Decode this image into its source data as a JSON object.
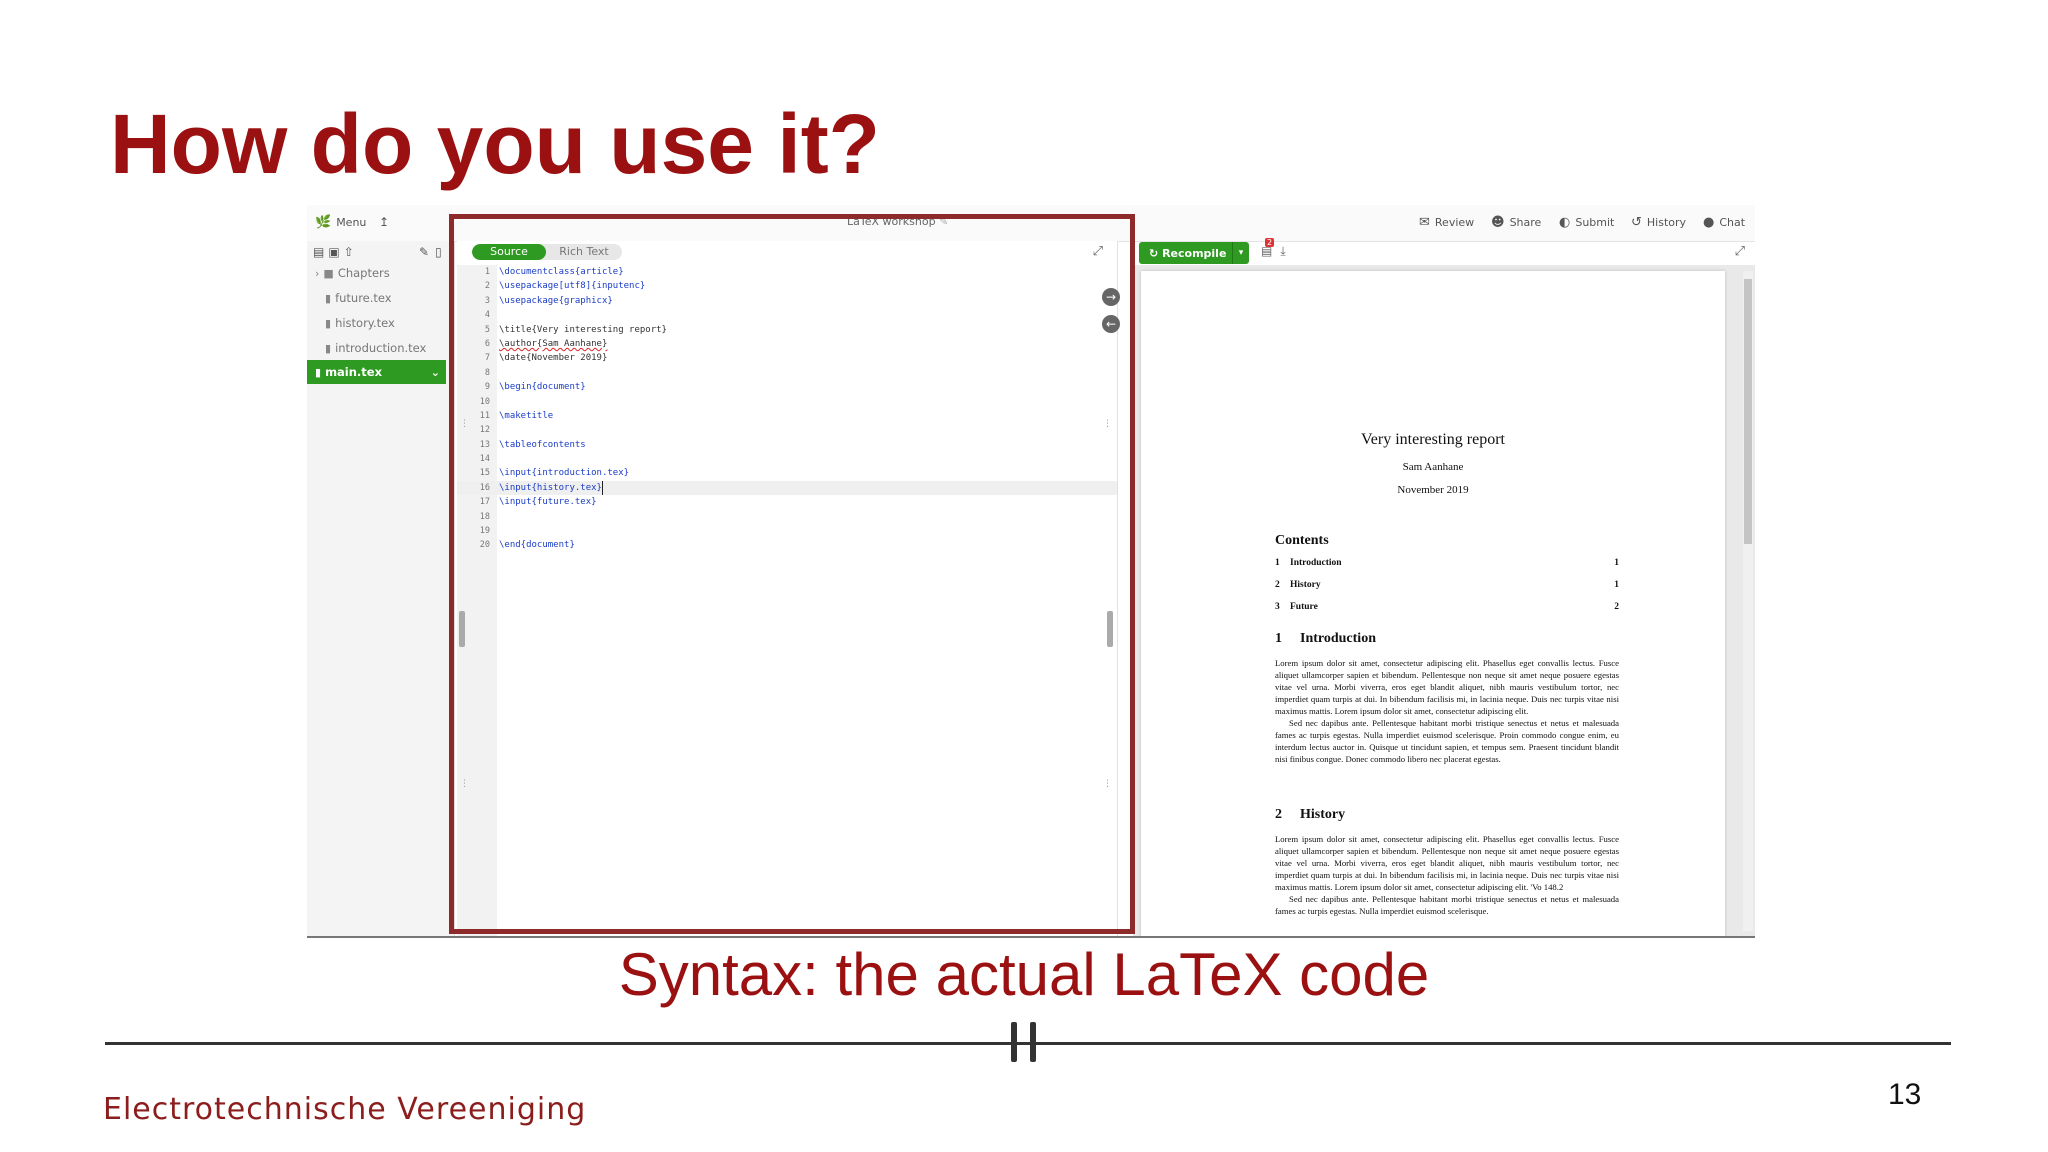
{
  "slide": {
    "title": "How do you use it?",
    "subtitle": "Syntax: the actual LaTeX code",
    "footer_org": "Electrotechnische Vereeniging",
    "page_number": "13"
  },
  "app": {
    "menu_label": "Menu",
    "project_title": "LaTeX workshop",
    "topbar_right": [
      {
        "label": "Review",
        "icon": "review-icon"
      },
      {
        "label": "Share",
        "icon": "share-icon"
      },
      {
        "label": "Submit",
        "icon": "submit-icon"
      },
      {
        "label": "History",
        "icon": "history-icon"
      },
      {
        "label": "Chat",
        "icon": "chat-icon"
      }
    ]
  },
  "file_tree": {
    "folder": "Chapters",
    "files": [
      "future.tex",
      "history.tex",
      "introduction.tex"
    ],
    "selected": "main.tex"
  },
  "editor": {
    "mode_source": "Source",
    "mode_rich": "Rich Text",
    "lines": [
      {
        "n": "1",
        "text": "\\documentclass{article}"
      },
      {
        "n": "2",
        "text": "\\usepackage[utf8]{inputenc}"
      },
      {
        "n": "3",
        "text": "\\usepackage{graphicx}"
      },
      {
        "n": "4",
        "text": ""
      },
      {
        "n": "5",
        "text": "\\title{Very interesting report}"
      },
      {
        "n": "6",
        "text": "\\author{Sam Aanhane}"
      },
      {
        "n": "7",
        "text": "\\date{November 2019}"
      },
      {
        "n": "8",
        "text": ""
      },
      {
        "n": "9",
        "text": "\\begin{document}"
      },
      {
        "n": "10",
        "text": ""
      },
      {
        "n": "11",
        "text": "\\maketitle"
      },
      {
        "n": "12",
        "text": ""
      },
      {
        "n": "13",
        "text": "\\tableofcontents"
      },
      {
        "n": "14",
        "text": ""
      },
      {
        "n": "15",
        "text": "\\input{introduction.tex}"
      },
      {
        "n": "16",
        "text": "\\input{history.tex}"
      },
      {
        "n": "17",
        "text": "\\input{future.tex}"
      },
      {
        "n": "18",
        "text": ""
      },
      {
        "n": "19",
        "text": ""
      },
      {
        "n": "20",
        "text": "\\end{document}"
      }
    ]
  },
  "pdf": {
    "recompile_label": "Recompile",
    "badge_count": "2",
    "doc_title": "Very interesting report",
    "author": "Sam Aanhane",
    "date": "November 2019",
    "contents_heading": "Contents",
    "toc": [
      {
        "num": "1",
        "title": "Introduction",
        "page": "1"
      },
      {
        "num": "2",
        "title": "History",
        "page": "1"
      },
      {
        "num": "3",
        "title": "Future",
        "page": "2"
      }
    ],
    "sec1_num": "1",
    "sec1_title": "Introduction",
    "sec1_p1": "Lorem ipsum dolor sit amet, consectetur adipiscing elit. Phasellus eget convallis lectus. Fusce aliquet ullamcorper sapien et bibendum. Pellentesque non neque sit amet neque posuere egestas vitae vel urna. Morbi viverra, eros eget blandit aliquet, nibh mauris vestibulum tortor, nec imperdiet quam turpis at dui. In bibendum facilisis mi, in lacinia neque. Duis nec turpis vitae nisi maximus mattis. Lorem ipsum dolor sit amet, consectetur adipiscing elit.",
    "sec1_p2": "Sed nec dapibus ante. Pellentesque habitant morbi tristique senectus et netus et malesuada fames ac turpis egestas. Nulla imperdiet euismod scelerisque. Proin commodo congue enim, eu interdum lectus auctor in. Quisque ut tincidunt sapien, et tempus sem. Praesent tincidunt blandit nisi finibus congue. Donec commodo libero nec placerat egestas.",
    "sec2_num": "2",
    "sec2_title": "History",
    "sec2_p1": "Lorem ipsum dolor sit amet, consectetur adipiscing elit. Phasellus eget convallis lectus. Fusce aliquet ullamcorper sapien et bibendum. Pellentesque non neque sit amet neque posuere egestas vitae vel urna. Morbi viverra, eros eget blandit aliquet, nibh mauris vestibulum tortor, nec imperdiet quam turpis at dui. In bibendum facilisis mi, in lacinia neque. Duis nec turpis vitae nisi maximus mattis. Lorem ipsum dolor sit amet, consectetur adipiscing elit. 'Vo 148.2",
    "sec2_p2": "Sed nec dapibus ante. Pellentesque habitant morbi tristique senectus et netus et malesuada fames ac turpis egestas. Nulla imperdiet euismod scelerisque."
  },
  "colors": {
    "title_red": "#9b1111",
    "frame_red": "#8f2a2a",
    "accent_green": "#2e9a22"
  }
}
